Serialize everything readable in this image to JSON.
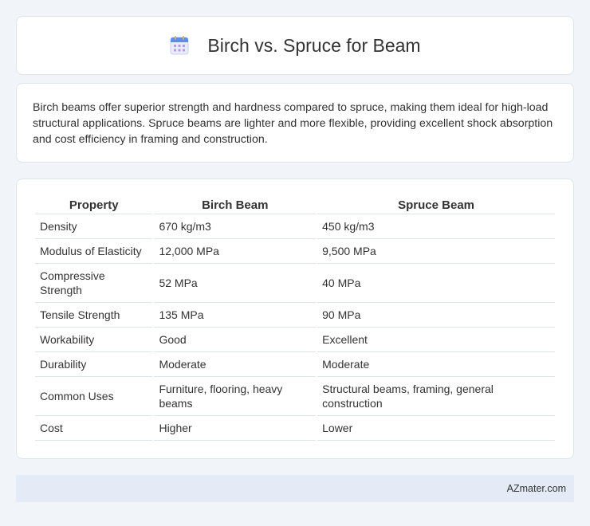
{
  "header": {
    "title": "Birch vs. Spruce for Beam",
    "icon": "calendar-icon"
  },
  "intro": {
    "text": "Birch beams offer superior strength and hardness compared to spruce, making them ideal for high-load structural applications. Spruce beams are lighter and more flexible, providing excellent shock absorption and cost efficiency in framing and construction."
  },
  "table": {
    "headers": [
      "Property",
      "Birch Beam",
      "Spruce Beam"
    ],
    "rows": [
      [
        "Density",
        "670 kg/m3",
        "450 kg/m3"
      ],
      [
        "Modulus of Elasticity",
        "12,000 MPa",
        "9,500 MPa"
      ],
      [
        "Compressive Strength",
        "52 MPa",
        "40 MPa"
      ],
      [
        "Tensile Strength",
        "135 MPa",
        "90 MPa"
      ],
      [
        "Workability",
        "Good",
        "Excellent"
      ],
      [
        "Durability",
        "Moderate",
        "Moderate"
      ],
      [
        "Common Uses",
        "Furniture, flooring, heavy beams",
        "Structural beams, framing, general construction"
      ],
      [
        "Cost",
        "Higher",
        "Lower"
      ]
    ]
  },
  "footer": {
    "text": "AZmater.com"
  },
  "colors": {
    "background": "#f1f4f9",
    "card": "#ffffff",
    "border": "#dfe4ec",
    "footer_bg": "#e4ebf6"
  }
}
